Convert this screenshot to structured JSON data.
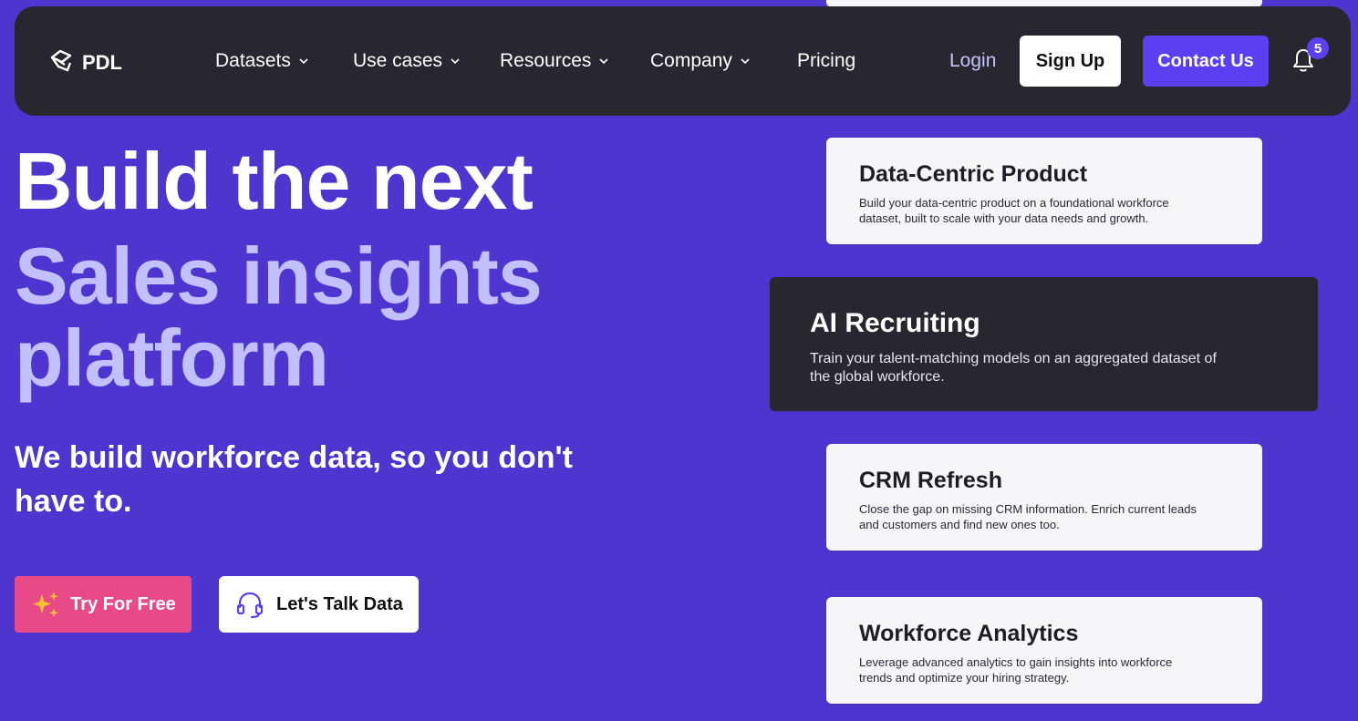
{
  "nav": {
    "logo_text": "PDL",
    "items": [
      {
        "label": "Datasets",
        "has_dropdown": true
      },
      {
        "label": "Use cases",
        "has_dropdown": true
      },
      {
        "label": "Resources",
        "has_dropdown": true
      },
      {
        "label": "Company",
        "has_dropdown": true
      },
      {
        "label": "Pricing",
        "has_dropdown": false
      }
    ],
    "login_label": "Login",
    "signup_label": "Sign Up",
    "contact_label": "Contact Us",
    "notification_count": "5"
  },
  "hero": {
    "line1": "Build the next",
    "line2": "Sales insights",
    "line3": "platform",
    "subhead": "We build workforce data, so you don't have to.",
    "try_label": "Try For Free",
    "talk_label": "Let's Talk Data"
  },
  "cards": [
    {
      "title": "Data-Centric Product",
      "description": "Build your data-centric product on a foundational workforce dataset, built to scale with your data needs and growth."
    },
    {
      "title": "AI Recruiting",
      "description": "Train your talent-matching models on an aggregated dataset of the global workforce."
    },
    {
      "title": "CRM Refresh",
      "description": "Close the gap on missing CRM information. Enrich current leads and customers and find new ones too."
    },
    {
      "title": "Workforce Analytics",
      "description": "Leverage advanced analytics to gain insights into workforce trends and optimize your hiring strategy."
    }
  ],
  "colors": {
    "background": "#4f35cf",
    "nav_bg": "#28262e",
    "accent": "#5b3ff0",
    "hero_highlight": "#c3c0ff",
    "try_button": "#e84a88"
  }
}
